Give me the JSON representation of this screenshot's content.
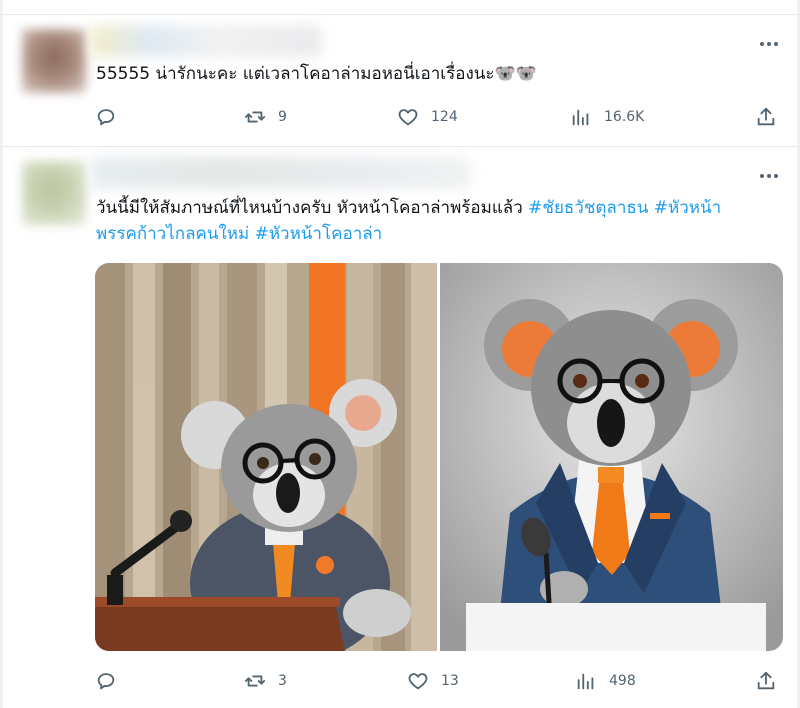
{
  "tweets": [
    {
      "text": "55555 น่ารักนะคะ แต่เวลาโคอาล่ามอหอนี่เอาเรื่องนะ🐨🐨",
      "actions": {
        "replies": "",
        "retweets": "9",
        "likes": "124",
        "views": "16.6K"
      }
    },
    {
      "text_plain": "วันนี้มีให้สัมภาษณ์ที่ไหนบ้างครับ หัวหน้าโคอาล่าพร้อมแล้ว ",
      "hashtags": [
        "#ชัยธวัชตุลาธน",
        "#หัวหน้าพรรคก้าวไกลคนใหม่",
        "#หัวหน้าโคอาล่า"
      ],
      "hashtag_break_a": "#หัวหน้า",
      "hashtag_break_b": "พรรคก้าวไกลคนใหม่",
      "actions": {
        "replies": "",
        "retweets": "3",
        "likes": "13",
        "views": "498"
      },
      "media": [
        "koala-at-podium-photo",
        "koala-in-suit-photo"
      ]
    }
  ],
  "colors": {
    "hashtag": "#1d9bf0",
    "icon": "#536471",
    "text": "#0f1419"
  }
}
